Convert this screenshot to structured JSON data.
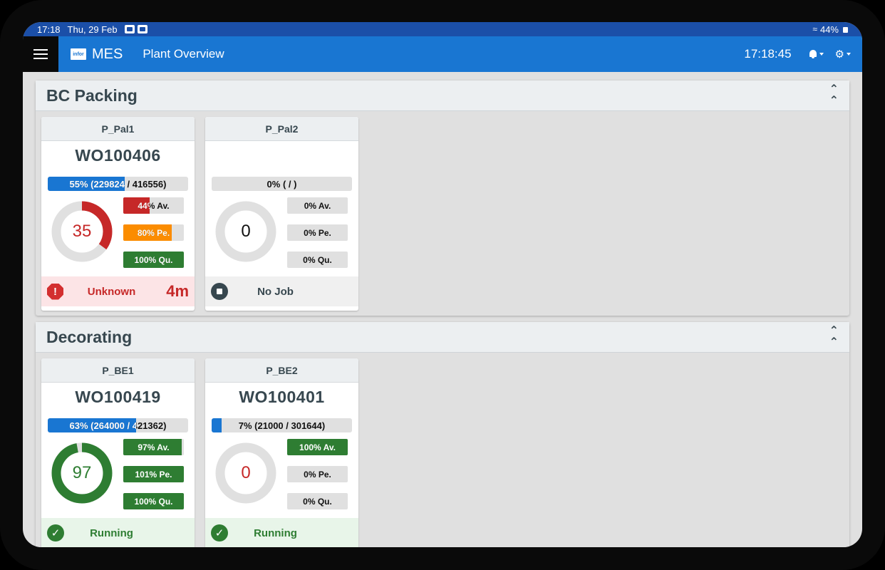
{
  "statusbar": {
    "time": "17:18",
    "date": "Thu, 29 Feb",
    "battery": "44%"
  },
  "appbar": {
    "logo": "infor",
    "app_name": "MES",
    "page_title": "Plant Overview",
    "clock": "17:18:45"
  },
  "colors": {
    "primary": "#1976d2",
    "danger": "#c62828",
    "warning": "#fb8c00",
    "success": "#2e7d32"
  },
  "sections": [
    {
      "title": "BC Packing",
      "cards": [
        {
          "name": "P_Pal1",
          "work_order": "WO100406",
          "progress_label": "55% (229824 / 416556)",
          "progress_fraction": 0.55,
          "oee": "35",
          "oee_fraction": 0.35,
          "availability": "44% Av.",
          "availability_fraction": 0.44,
          "performance": "80% Pe.",
          "performance_fraction": 0.8,
          "quality": "100% Qu.",
          "quality_fraction": 1.0,
          "status": "Unknown",
          "duration": "4m"
        },
        {
          "name": "P_Pal2",
          "work_order": "",
          "progress_label": "0% ( / )",
          "progress_fraction": 0,
          "oee": "0",
          "oee_fraction": 0,
          "availability": "0% Av.",
          "availability_fraction": 0,
          "performance": "0% Pe.",
          "performance_fraction": 0,
          "quality": "0% Qu.",
          "quality_fraction": 0,
          "status": "No Job",
          "duration": ""
        }
      ]
    },
    {
      "title": "Decorating",
      "cards": [
        {
          "name": "P_BE1",
          "work_order": "WO100419",
          "progress_label": "63% (264000 / 421362)",
          "progress_fraction": 0.63,
          "oee": "97",
          "oee_fraction": 0.97,
          "availability": "97% Av.",
          "availability_fraction": 0.97,
          "performance": "101% Pe.",
          "performance_fraction": 1.0,
          "quality": "100% Qu.",
          "quality_fraction": 1.0,
          "status": "Running",
          "duration": ""
        },
        {
          "name": "P_BE2",
          "work_order": "WO100401",
          "progress_label": "7% (21000 / 301644)",
          "progress_fraction": 0.07,
          "oee": "0",
          "oee_fraction": 0,
          "availability": "100% Av.",
          "availability_fraction": 1.0,
          "performance": "0% Pe.",
          "performance_fraction": 0,
          "quality": "0% Qu.",
          "quality_fraction": 0,
          "status": "Running",
          "duration": ""
        }
      ]
    }
  ]
}
